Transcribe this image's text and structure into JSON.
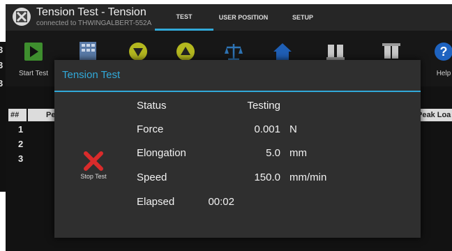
{
  "app": {
    "title": "Tension Test - Tension",
    "subtitle": "connected to THWINGALBERT-552A",
    "accent_color": "#31a9d9",
    "icon": "machine-logo-icon"
  },
  "tabs": [
    {
      "label": "TEST",
      "active": true
    },
    {
      "label": "USER POSITION",
      "active": false
    },
    {
      "label": "SETUP",
      "active": false
    }
  ],
  "toolbar": {
    "items": [
      {
        "icon": "play-icon",
        "label": "Start Test"
      },
      {
        "icon": "calculator-icon",
        "label": ""
      },
      {
        "icon": "arrow-down-circle-icon",
        "label": ""
      },
      {
        "icon": "arrow-up-circle-icon",
        "label": ""
      },
      {
        "icon": "scale-icon",
        "label": ""
      },
      {
        "icon": "home-icon",
        "label": ""
      },
      {
        "icon": "grips-open-icon",
        "label": ""
      },
      {
        "icon": "grips-closed-icon",
        "label": ""
      },
      {
        "icon": "help-icon",
        "label": "Help"
      }
    ]
  },
  "table": {
    "columns": [
      "##",
      "Pe",
      "Peak Loa"
    ],
    "rows": [
      "1",
      "2",
      "3"
    ]
  },
  "left_edge_fragments": [
    "3",
    "3",
    "3"
  ],
  "dialog": {
    "title": "Tension Test",
    "stop_button": {
      "icon": "stop-x-icon",
      "label": "Stop Test"
    },
    "fields": [
      {
        "label": "Status",
        "value": "Testing",
        "unit": ""
      },
      {
        "label": "Force",
        "value": "0.001",
        "unit": "N"
      },
      {
        "label": "Elongation",
        "value": "5.0",
        "unit": "mm"
      },
      {
        "label": "Speed",
        "value": "150.0",
        "unit": "mm/min"
      },
      {
        "label": "Elapsed",
        "value": "00:02",
        "unit": ""
      }
    ]
  }
}
